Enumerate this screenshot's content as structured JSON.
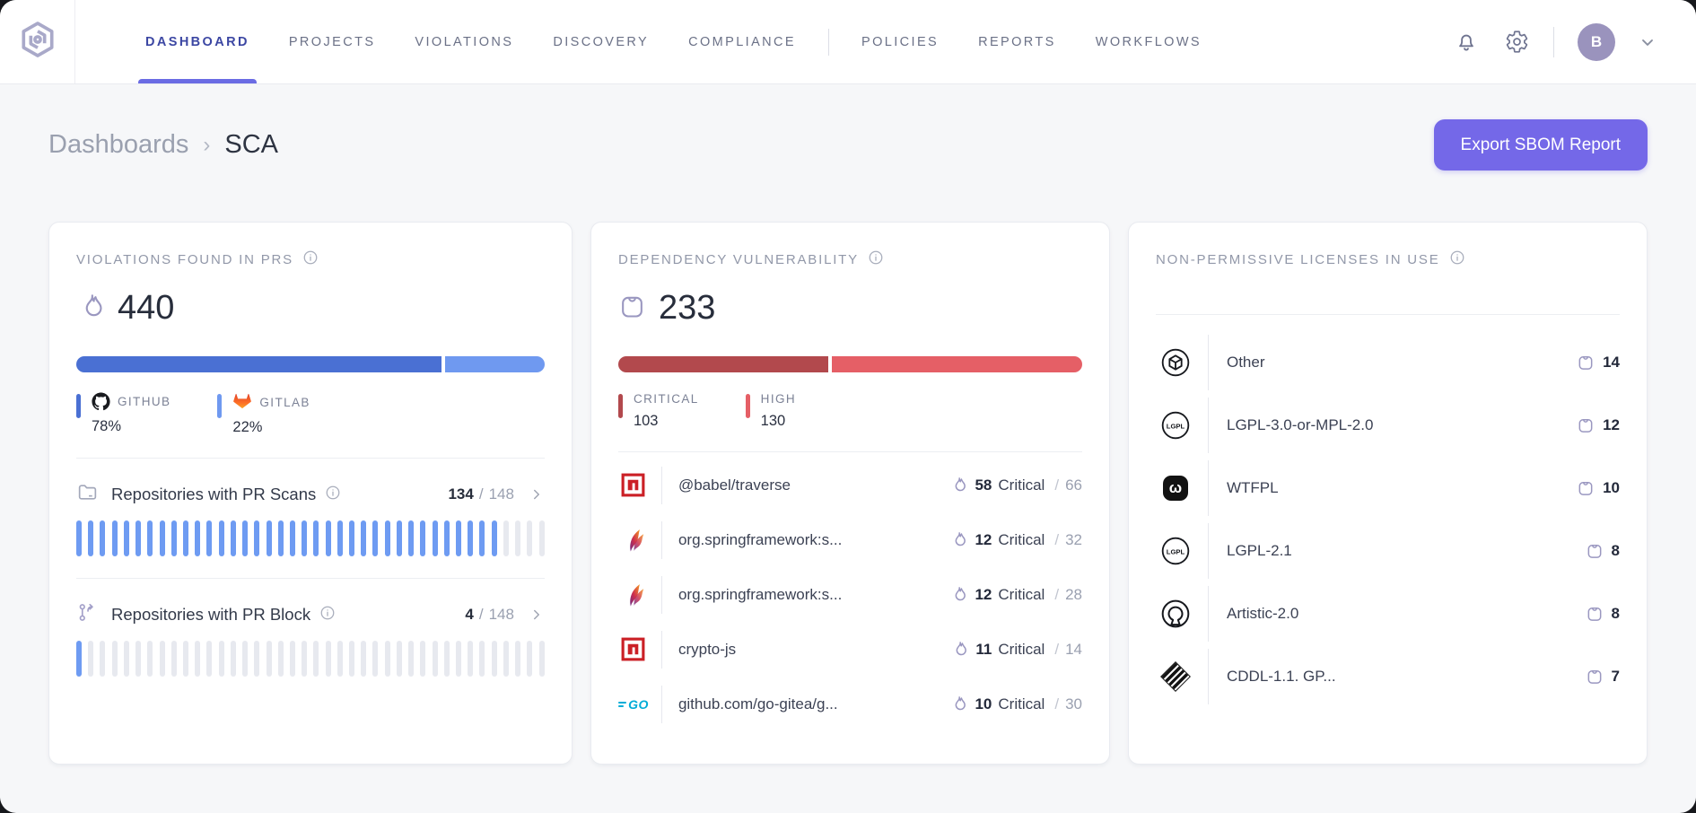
{
  "nav": {
    "primary": [
      {
        "label": "DASHBOARD",
        "active": true
      },
      {
        "label": "PROJECTS",
        "active": false
      },
      {
        "label": "VIOLATIONS",
        "active": false
      },
      {
        "label": "DISCOVERY",
        "active": false
      },
      {
        "label": "COMPLIANCE",
        "active": false
      }
    ],
    "secondary": [
      {
        "label": "POLICIES",
        "active": false
      },
      {
        "label": "REPORTS",
        "active": false
      },
      {
        "label": "WORKFLOWS",
        "active": false
      }
    ],
    "avatar_initial": "B"
  },
  "breadcrumb": {
    "parent": "Dashboards",
    "separator": "›",
    "current": "SCA"
  },
  "export_button_label": "Export SBOM Report",
  "colors": {
    "accent": "#7468e8",
    "blue_dark": "#4a70d3",
    "blue_light": "#6f99f0",
    "red_dark": "#b2494d",
    "red_light": "#e55f66",
    "license_bar": "#6c63dc"
  },
  "cards": {
    "violations": {
      "title": "VIOLATIONS FOUND IN PRS",
      "total": "440",
      "bar": {
        "github_pct": 78,
        "gitlab_pct": 22
      },
      "legend": [
        {
          "source": "github",
          "label": "GITHUB",
          "value": "78%",
          "color": "#4a70d3"
        },
        {
          "source": "gitlab",
          "label": "GITLAB",
          "value": "22%",
          "color": "#6f99f0"
        }
      ],
      "pr_scans": {
        "label": "Repositories with PR Scans",
        "value": "134",
        "slash": "/",
        "total": "148",
        "segments": 40,
        "filled": 36
      },
      "pr_block": {
        "label": "Repositories with PR Block",
        "value": "4",
        "slash": "/",
        "total": "148",
        "segments": 40,
        "filled": 1
      }
    },
    "dependency": {
      "title": "DEPENDENCY VULNERABILITY",
      "total": "233",
      "bar": {
        "critical_pct": 45.3
      },
      "legend": [
        {
          "label": "CRITICAL",
          "value": "103",
          "color": "#b2494d"
        },
        {
          "label": "HIGH",
          "value": "130",
          "color": "#e55f66"
        }
      ],
      "critical_word": "Critical",
      "slash": "/",
      "rows": [
        {
          "ecosystem": "npm",
          "name": "@babel/traverse",
          "critical": "58",
          "total": "66"
        },
        {
          "ecosystem": "maven",
          "name": "org.springframework:s...",
          "critical": "12",
          "total": "32"
        },
        {
          "ecosystem": "maven",
          "name": "org.springframework:s...",
          "critical": "12",
          "total": "28"
        },
        {
          "ecosystem": "npm",
          "name": "crypto-js",
          "critical": "11",
          "total": "14"
        },
        {
          "ecosystem": "go",
          "name": "github.com/go-gitea/g...",
          "critical": "10",
          "total": "30"
        }
      ]
    },
    "licenses": {
      "title": "NON-PERMISSIVE LICENSES IN USE",
      "rows": [
        {
          "icon": "package",
          "name": "Other",
          "count": "14",
          "pct": 42
        },
        {
          "icon": "lgpl",
          "name": "LGPL-3.0-or-MPL-2.0",
          "count": "12",
          "pct": 36
        },
        {
          "icon": "wtfpl",
          "name": "WTFPL",
          "count": "10",
          "pct": 29
        },
        {
          "icon": "lgpl",
          "name": "LGPL-2.1",
          "count": "8",
          "pct": 26
        },
        {
          "icon": "osi",
          "name": "Artistic-2.0",
          "count": "8",
          "pct": 26
        },
        {
          "icon": "cddl",
          "name": "CDDL-1.1. GP...",
          "count": "7",
          "pct": 18
        }
      ]
    }
  }
}
